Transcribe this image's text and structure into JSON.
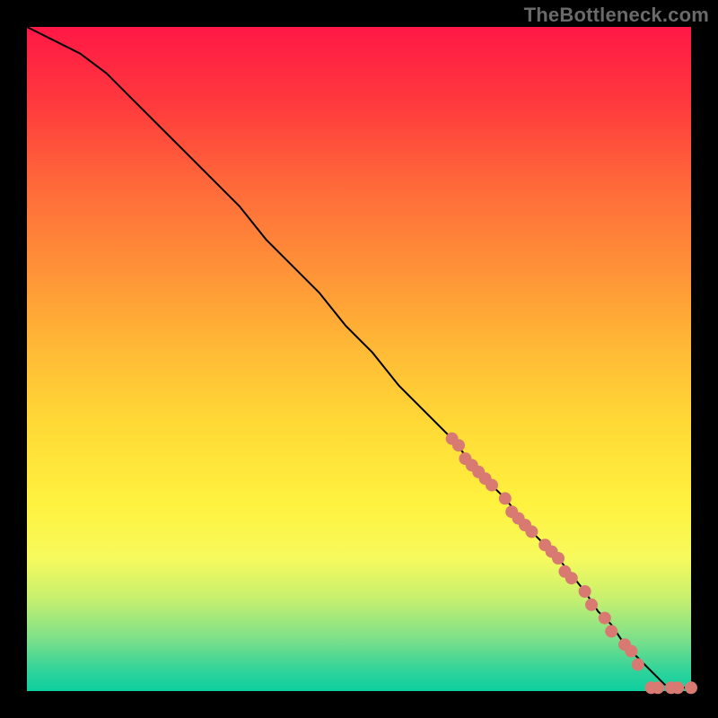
{
  "watermark": "TheBottleneck.com",
  "colors": {
    "background": "#000000",
    "curve": "#000000",
    "marker": "#d87a72",
    "gradient_top": "#ff1846",
    "gradient_bottom": "#0dcf9f"
  },
  "chart_data": {
    "type": "line",
    "title": "",
    "xlabel": "",
    "ylabel": "",
    "xlim": [
      0,
      100
    ],
    "ylim": [
      0,
      100
    ],
    "grid": false,
    "series": [
      {
        "name": "curve",
        "x": [
          0,
          4,
          8,
          12,
          16,
          20,
          24,
          28,
          32,
          36,
          40,
          44,
          48,
          52,
          56,
          60,
          64,
          68,
          72,
          76,
          80,
          84,
          86,
          88,
          90,
          92,
          94,
          95,
          96,
          97,
          98,
          99,
          100
        ],
        "y": [
          100,
          98,
          96,
          93,
          89,
          85,
          81,
          77,
          73,
          68,
          64,
          60,
          55,
          51,
          46,
          42,
          38,
          33,
          29,
          24,
          20,
          15,
          12,
          10,
          7,
          5,
          3,
          2,
          1,
          0.5,
          0.5,
          0.5,
          0.5
        ]
      }
    ],
    "markers": [
      {
        "x": 64,
        "y": 38
      },
      {
        "x": 65,
        "y": 37
      },
      {
        "x": 66,
        "y": 35
      },
      {
        "x": 67,
        "y": 34
      },
      {
        "x": 68,
        "y": 33
      },
      {
        "x": 69,
        "y": 32
      },
      {
        "x": 70,
        "y": 31
      },
      {
        "x": 72,
        "y": 29
      },
      {
        "x": 73,
        "y": 27
      },
      {
        "x": 74,
        "y": 26
      },
      {
        "x": 75,
        "y": 25
      },
      {
        "x": 76,
        "y": 24
      },
      {
        "x": 78,
        "y": 22
      },
      {
        "x": 79,
        "y": 21
      },
      {
        "x": 80,
        "y": 20
      },
      {
        "x": 81,
        "y": 18
      },
      {
        "x": 82,
        "y": 17
      },
      {
        "x": 84,
        "y": 15
      },
      {
        "x": 85,
        "y": 13
      },
      {
        "x": 87,
        "y": 11
      },
      {
        "x": 88,
        "y": 9
      },
      {
        "x": 90,
        "y": 7
      },
      {
        "x": 91,
        "y": 6
      },
      {
        "x": 92,
        "y": 4
      },
      {
        "x": 94,
        "y": 0.5
      },
      {
        "x": 95,
        "y": 0.5
      },
      {
        "x": 97,
        "y": 0.5
      },
      {
        "x": 98,
        "y": 0.5
      },
      {
        "x": 100,
        "y": 0.5
      }
    ],
    "marker_radius_px": 7
  }
}
